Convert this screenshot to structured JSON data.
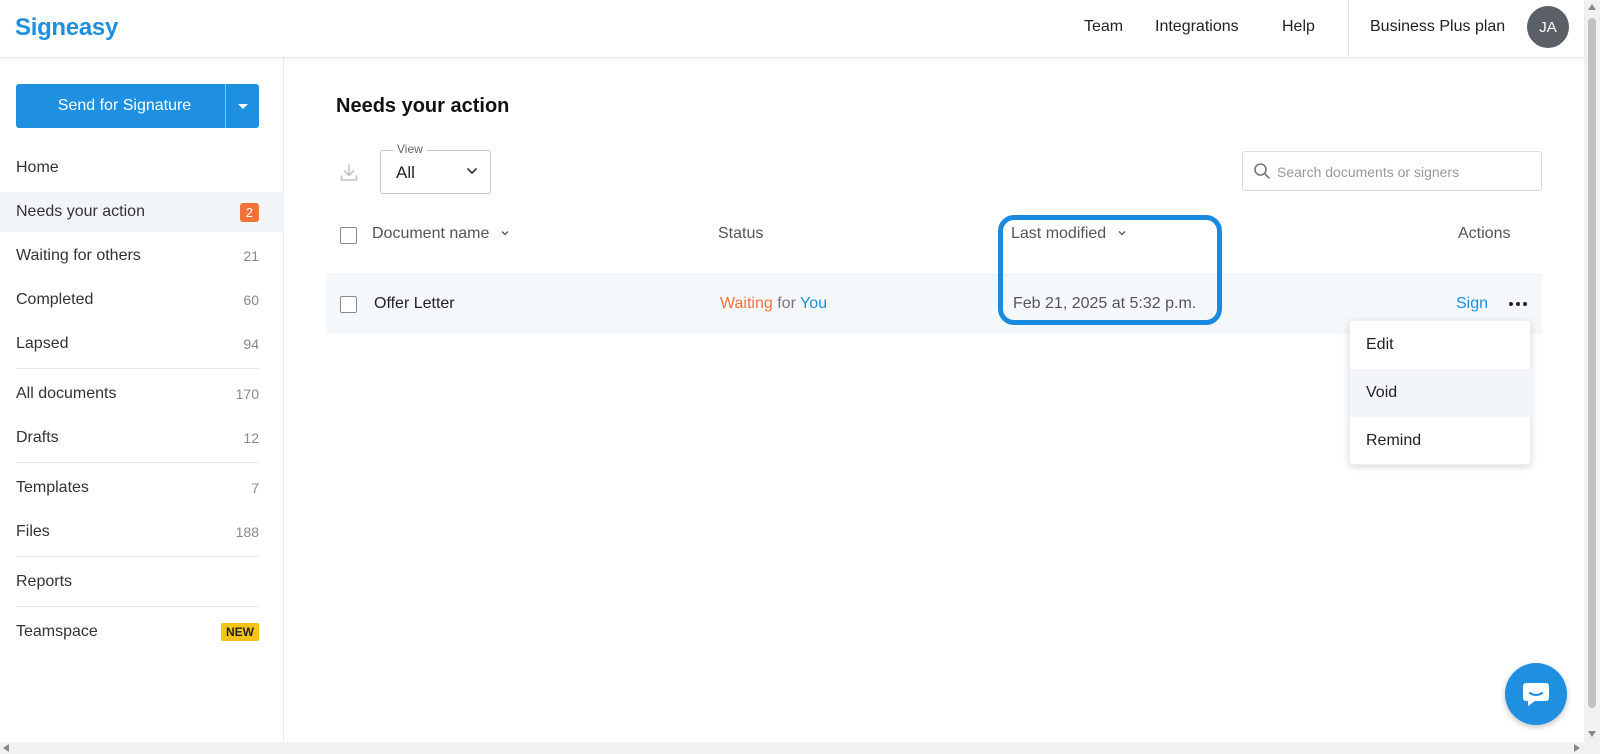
{
  "header": {
    "logo": "Signeasy",
    "nav": [
      "Team",
      "Integrations",
      "Help"
    ],
    "plan": "Business Plus plan",
    "avatar_initials": "JA"
  },
  "sidebar": {
    "send_button": "Send for Signature",
    "items": [
      {
        "label": "Home",
        "count": ""
      },
      {
        "label": "Needs your action",
        "count": "2"
      },
      {
        "label": "Waiting for others",
        "count": "21"
      },
      {
        "label": "Completed",
        "count": "60"
      },
      {
        "label": "Lapsed",
        "count": "94"
      },
      {
        "label": "All documents",
        "count": "170"
      },
      {
        "label": "Drafts",
        "count": "12"
      },
      {
        "label": "Templates",
        "count": "7"
      },
      {
        "label": "Files",
        "count": "188"
      },
      {
        "label": "Reports",
        "count": ""
      },
      {
        "label": "Teamspace",
        "badge": "NEW"
      }
    ]
  },
  "main": {
    "title": "Needs your action",
    "view": {
      "label": "View",
      "value": "All"
    },
    "search": {
      "placeholder": "Search documents or signers",
      "value": ""
    },
    "columns": {
      "document_name": "Document name",
      "status": "Status",
      "last_modified": "Last modified",
      "actions": "Actions"
    },
    "rows": [
      {
        "document_name": "Offer Letter",
        "status": {
          "waiting": "Waiting",
          "for": "for",
          "who": "You"
        },
        "last_modified": "Feb 21, 2025 at 5:32 p.m.",
        "action": "Sign"
      }
    ],
    "menu": [
      "Edit",
      "Void",
      "Remind"
    ]
  },
  "colors": {
    "brand": "#1f8fe0",
    "status_waiting": "#f0743a",
    "badge_new": "#f6c417",
    "highlight": "#1a8ae0"
  },
  "icons": [
    "download-icon",
    "chevron-down-icon",
    "search-icon",
    "more-icon",
    "chat-icon"
  ]
}
